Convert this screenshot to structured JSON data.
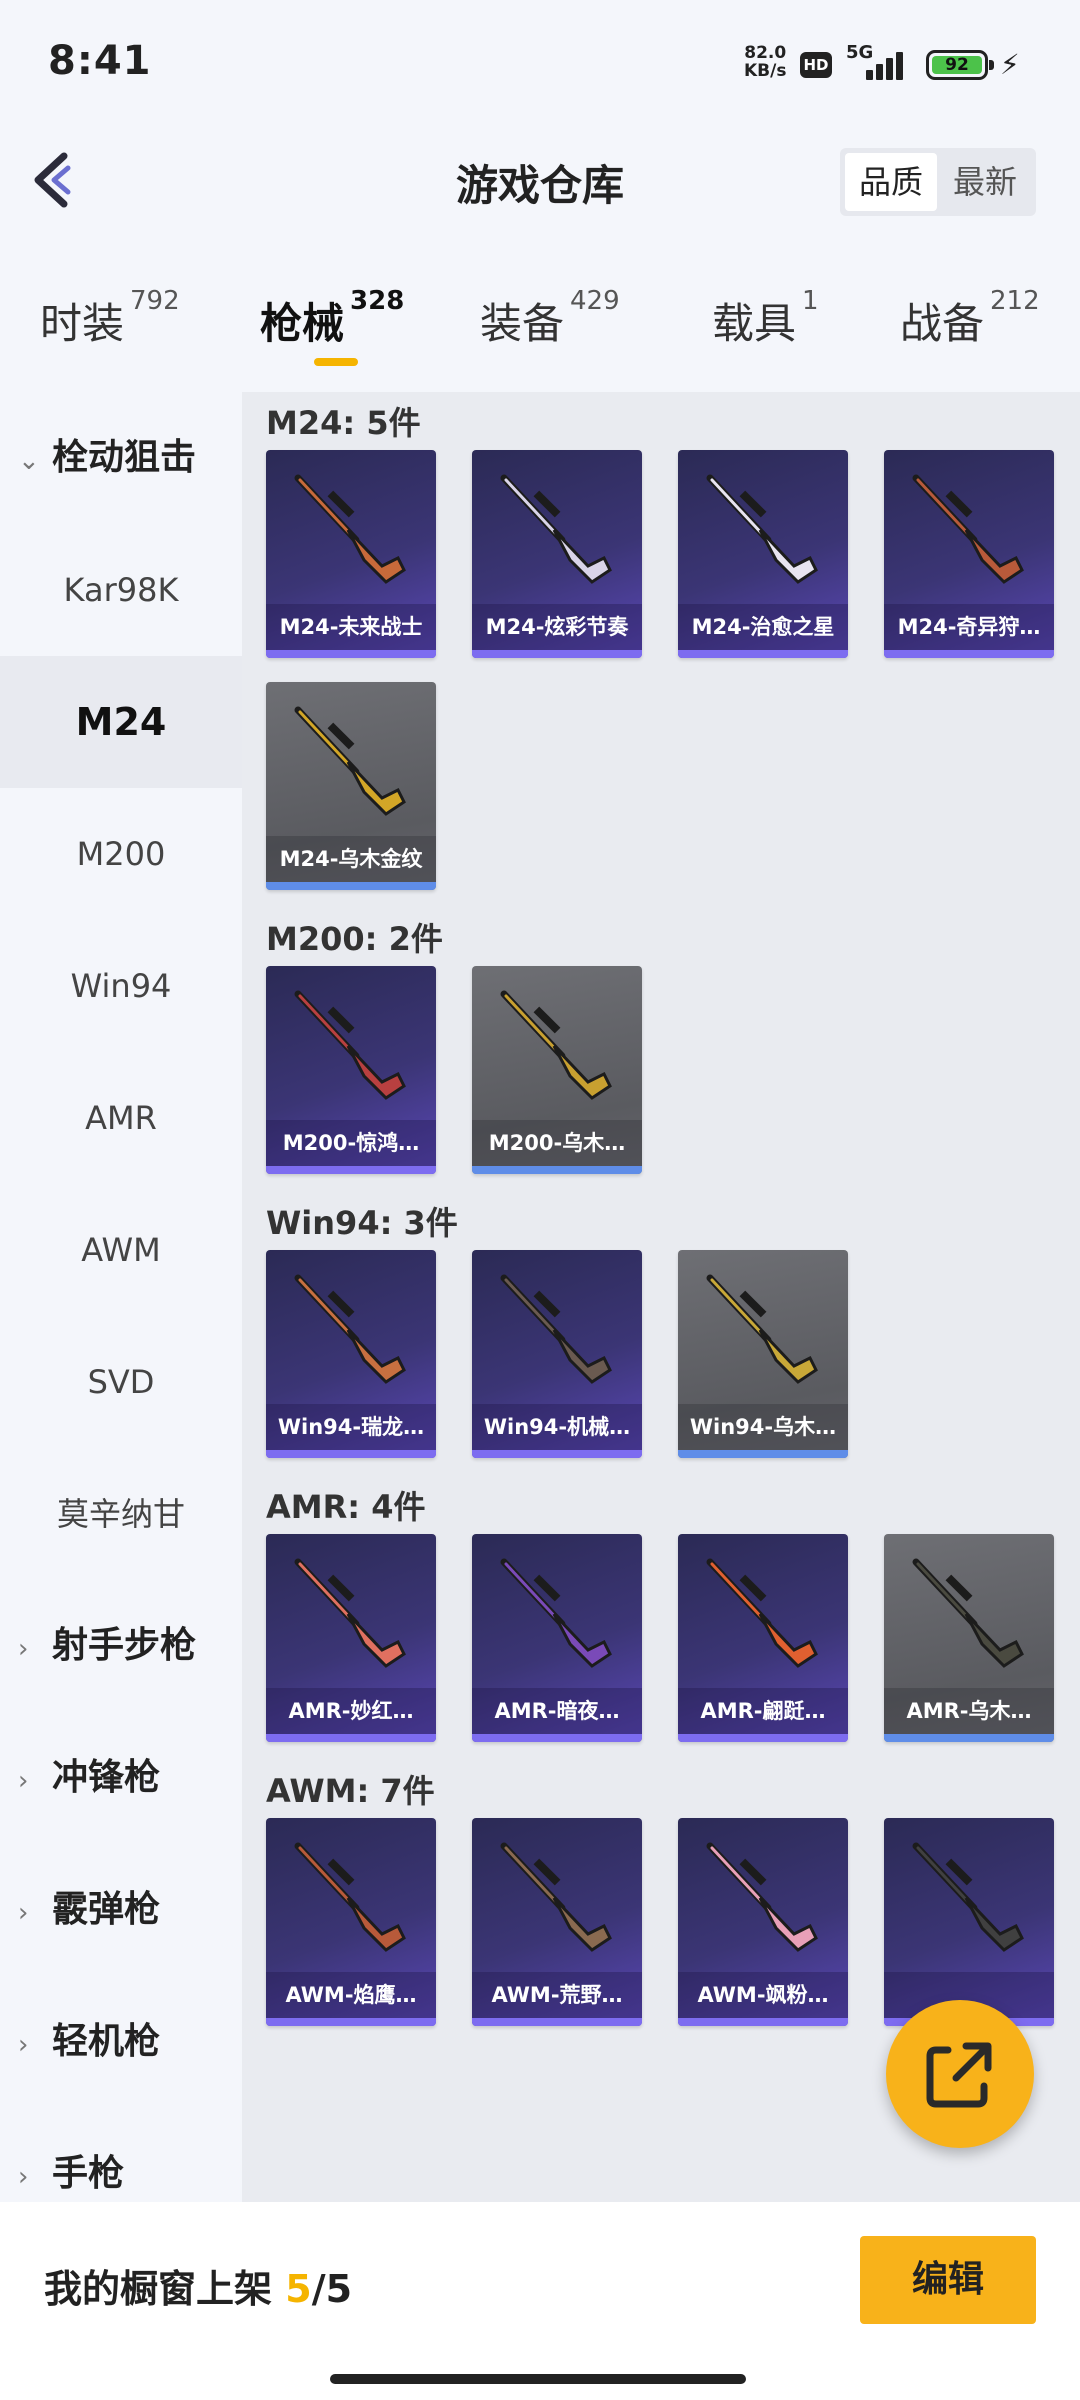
{
  "status_bar": {
    "time": "8:41",
    "net_speed": "82.0",
    "net_unit": "KB/s",
    "hd": "HD",
    "network": "5G",
    "battery": "92"
  },
  "header": {
    "title": "游戏仓库",
    "sort_options": [
      "品质",
      "最新"
    ],
    "sort_active": "品质"
  },
  "tabs": [
    {
      "label": "时装",
      "count": "792"
    },
    {
      "label": "枪械",
      "count": "328",
      "active": true
    },
    {
      "label": "装备",
      "count": "429"
    },
    {
      "label": "载具",
      "count": "1"
    },
    {
      "label": "战备",
      "count": "212"
    }
  ],
  "sidebar": {
    "group_open": "栓动狙击",
    "items": [
      "Kar98K",
      "M24",
      "M200",
      "Win94",
      "AMR",
      "AWM",
      "SVD",
      "莫辛纳甘"
    ],
    "active_item": "M24",
    "groups_closed": [
      "射手步枪",
      "冲锋枪",
      "霰弹枪",
      "轻机枪",
      "手枪"
    ]
  },
  "sections": [
    {
      "title": "M24: 5件",
      "items": [
        {
          "label": "M24-未来战士",
          "style": "purple"
        },
        {
          "label": "M24-炫彩节奏",
          "style": "purple"
        },
        {
          "label": "M24-治愈之星",
          "style": "purple"
        },
        {
          "label": "M24-奇异狩…",
          "style": "purple"
        },
        {
          "label": "M24-乌木金纹",
          "style": "grey"
        }
      ]
    },
    {
      "title": "M200: 2件",
      "items": [
        {
          "label": "M200-惊鸿…",
          "style": "purple"
        },
        {
          "label": "M200-乌木…",
          "style": "grey"
        }
      ]
    },
    {
      "title": "Win94: 3件",
      "items": [
        {
          "label": "Win94-瑞龙…",
          "style": "purple"
        },
        {
          "label": "Win94-机械…",
          "style": "purple"
        },
        {
          "label": "Win94-乌木…",
          "style": "grey"
        }
      ]
    },
    {
      "title": "AMR: 4件",
      "items": [
        {
          "label": "AMR-妙红…",
          "style": "purple"
        },
        {
          "label": "AMR-暗夜…",
          "style": "purple"
        },
        {
          "label": "AMR-翩跹…",
          "style": "purple"
        },
        {
          "label": "AMR-乌木…",
          "style": "grey"
        }
      ]
    },
    {
      "title": "AWM: 7件",
      "items": [
        {
          "label": "AWM-焰鹰…",
          "style": "purple"
        },
        {
          "label": "AWM-荒野…",
          "style": "purple"
        },
        {
          "label": "AWM-飒粉…",
          "style": "purple"
        },
        {
          "label": "",
          "style": "purple"
        }
      ]
    }
  ],
  "bottom": {
    "showcase_label": "我的橱窗上架",
    "showcase_current": "5",
    "showcase_total": "/5",
    "edit_label": "编辑"
  },
  "colors": {
    "accent": "#f5b400",
    "card_purple": "#3b3575",
    "card_grey": "#5f6065"
  },
  "icons": {
    "back": "back-arrow-icon",
    "fab": "share-export-icon"
  }
}
